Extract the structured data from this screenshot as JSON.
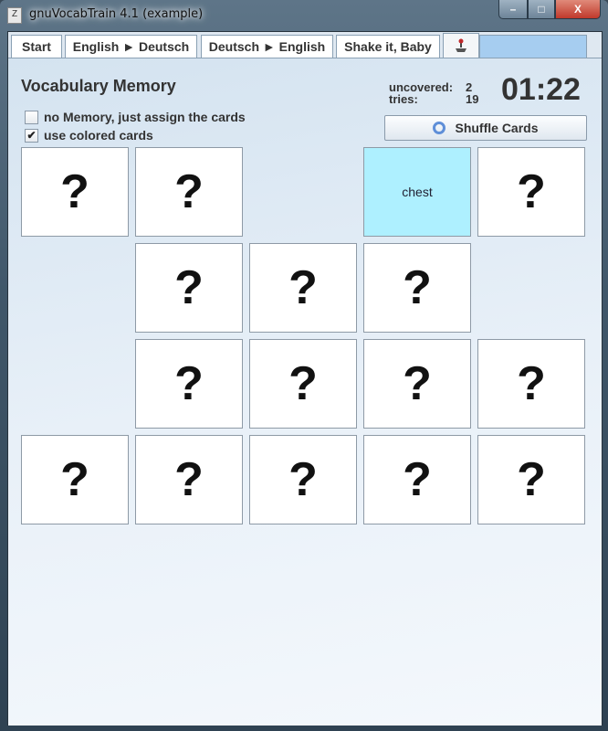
{
  "window": {
    "title": "gnuVocabTrain 4.1 (example)",
    "app_icon": "app-icon",
    "controls": {
      "minimize": "–",
      "maximize": "□",
      "close": "X"
    }
  },
  "tabs": [
    {
      "label": "Start",
      "selected": false
    },
    {
      "label": "English ► Deutsch",
      "selected": false
    },
    {
      "label": "Deutsch ► English",
      "selected": false
    },
    {
      "label": "Shake it, Baby",
      "selected": false
    },
    {
      "label": "",
      "icon": "joystick-icon",
      "selected": true
    }
  ],
  "memory": {
    "title": "Vocabulary Memory",
    "options": [
      {
        "label": "no Memory, just assign the cards",
        "checked": false
      },
      {
        "label": "use colored cards",
        "checked": true
      }
    ],
    "stats": {
      "uncovered_label": "uncovered:",
      "uncovered_value": "2",
      "tries_label": "tries:",
      "tries_value": "19"
    },
    "timer": "01:22",
    "shuffle_label": "Shuffle Cards",
    "hidden_symbol": "?",
    "open_color": "#aef0ff",
    "cards": [
      [
        "?",
        "?",
        null,
        "chest",
        "?"
      ],
      [
        null,
        "?",
        "?",
        "?",
        null
      ],
      [
        null,
        "?",
        "?",
        "?",
        "?"
      ],
      [
        "?",
        "?",
        "?",
        "?",
        "?"
      ]
    ]
  }
}
